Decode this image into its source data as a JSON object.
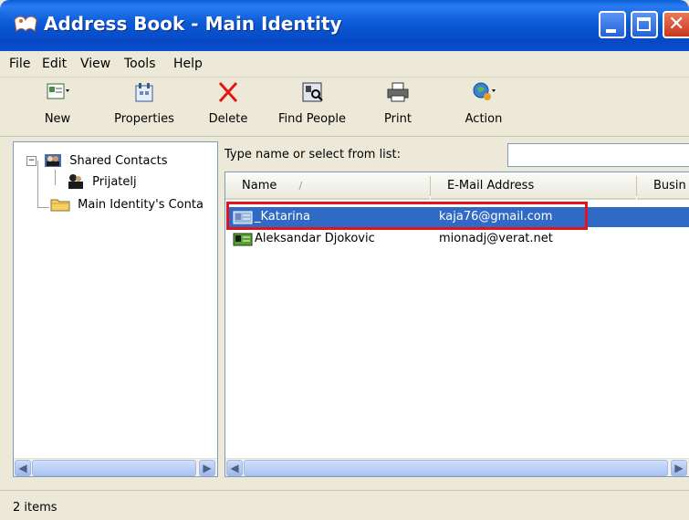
{
  "window": {
    "title": "Address Book - Main Identity"
  },
  "menu": [
    "File",
    "Edit",
    "View",
    "Tools",
    "Help"
  ],
  "toolbar": {
    "new": "New",
    "properties": "Properties",
    "delete": "Delete",
    "find_people": "Find People",
    "print": "Print",
    "action": "Action"
  },
  "tree": {
    "shared_contacts": "Shared Contacts",
    "prijatelj": "Prijatelj",
    "main_identity_contacts": "Main Identity's Conta"
  },
  "search": {
    "label": "Type name or select from list:",
    "value": ""
  },
  "list": {
    "columns": [
      "Name",
      "E-Mail Address",
      "Busin"
    ],
    "rows": [
      {
        "name": "_Katarina",
        "email": "kaja76@gmail.com",
        "selected": true
      },
      {
        "name": "Aleksandar Djokovic",
        "email": "mionadj@verat.net",
        "selected": false
      }
    ]
  },
  "status": {
    "text": "2 items"
  },
  "colors": {
    "titlebar": "#0b5ad6",
    "selection": "#316ac5",
    "highlight": "#e0141e",
    "chrome": "#ece9d8"
  }
}
